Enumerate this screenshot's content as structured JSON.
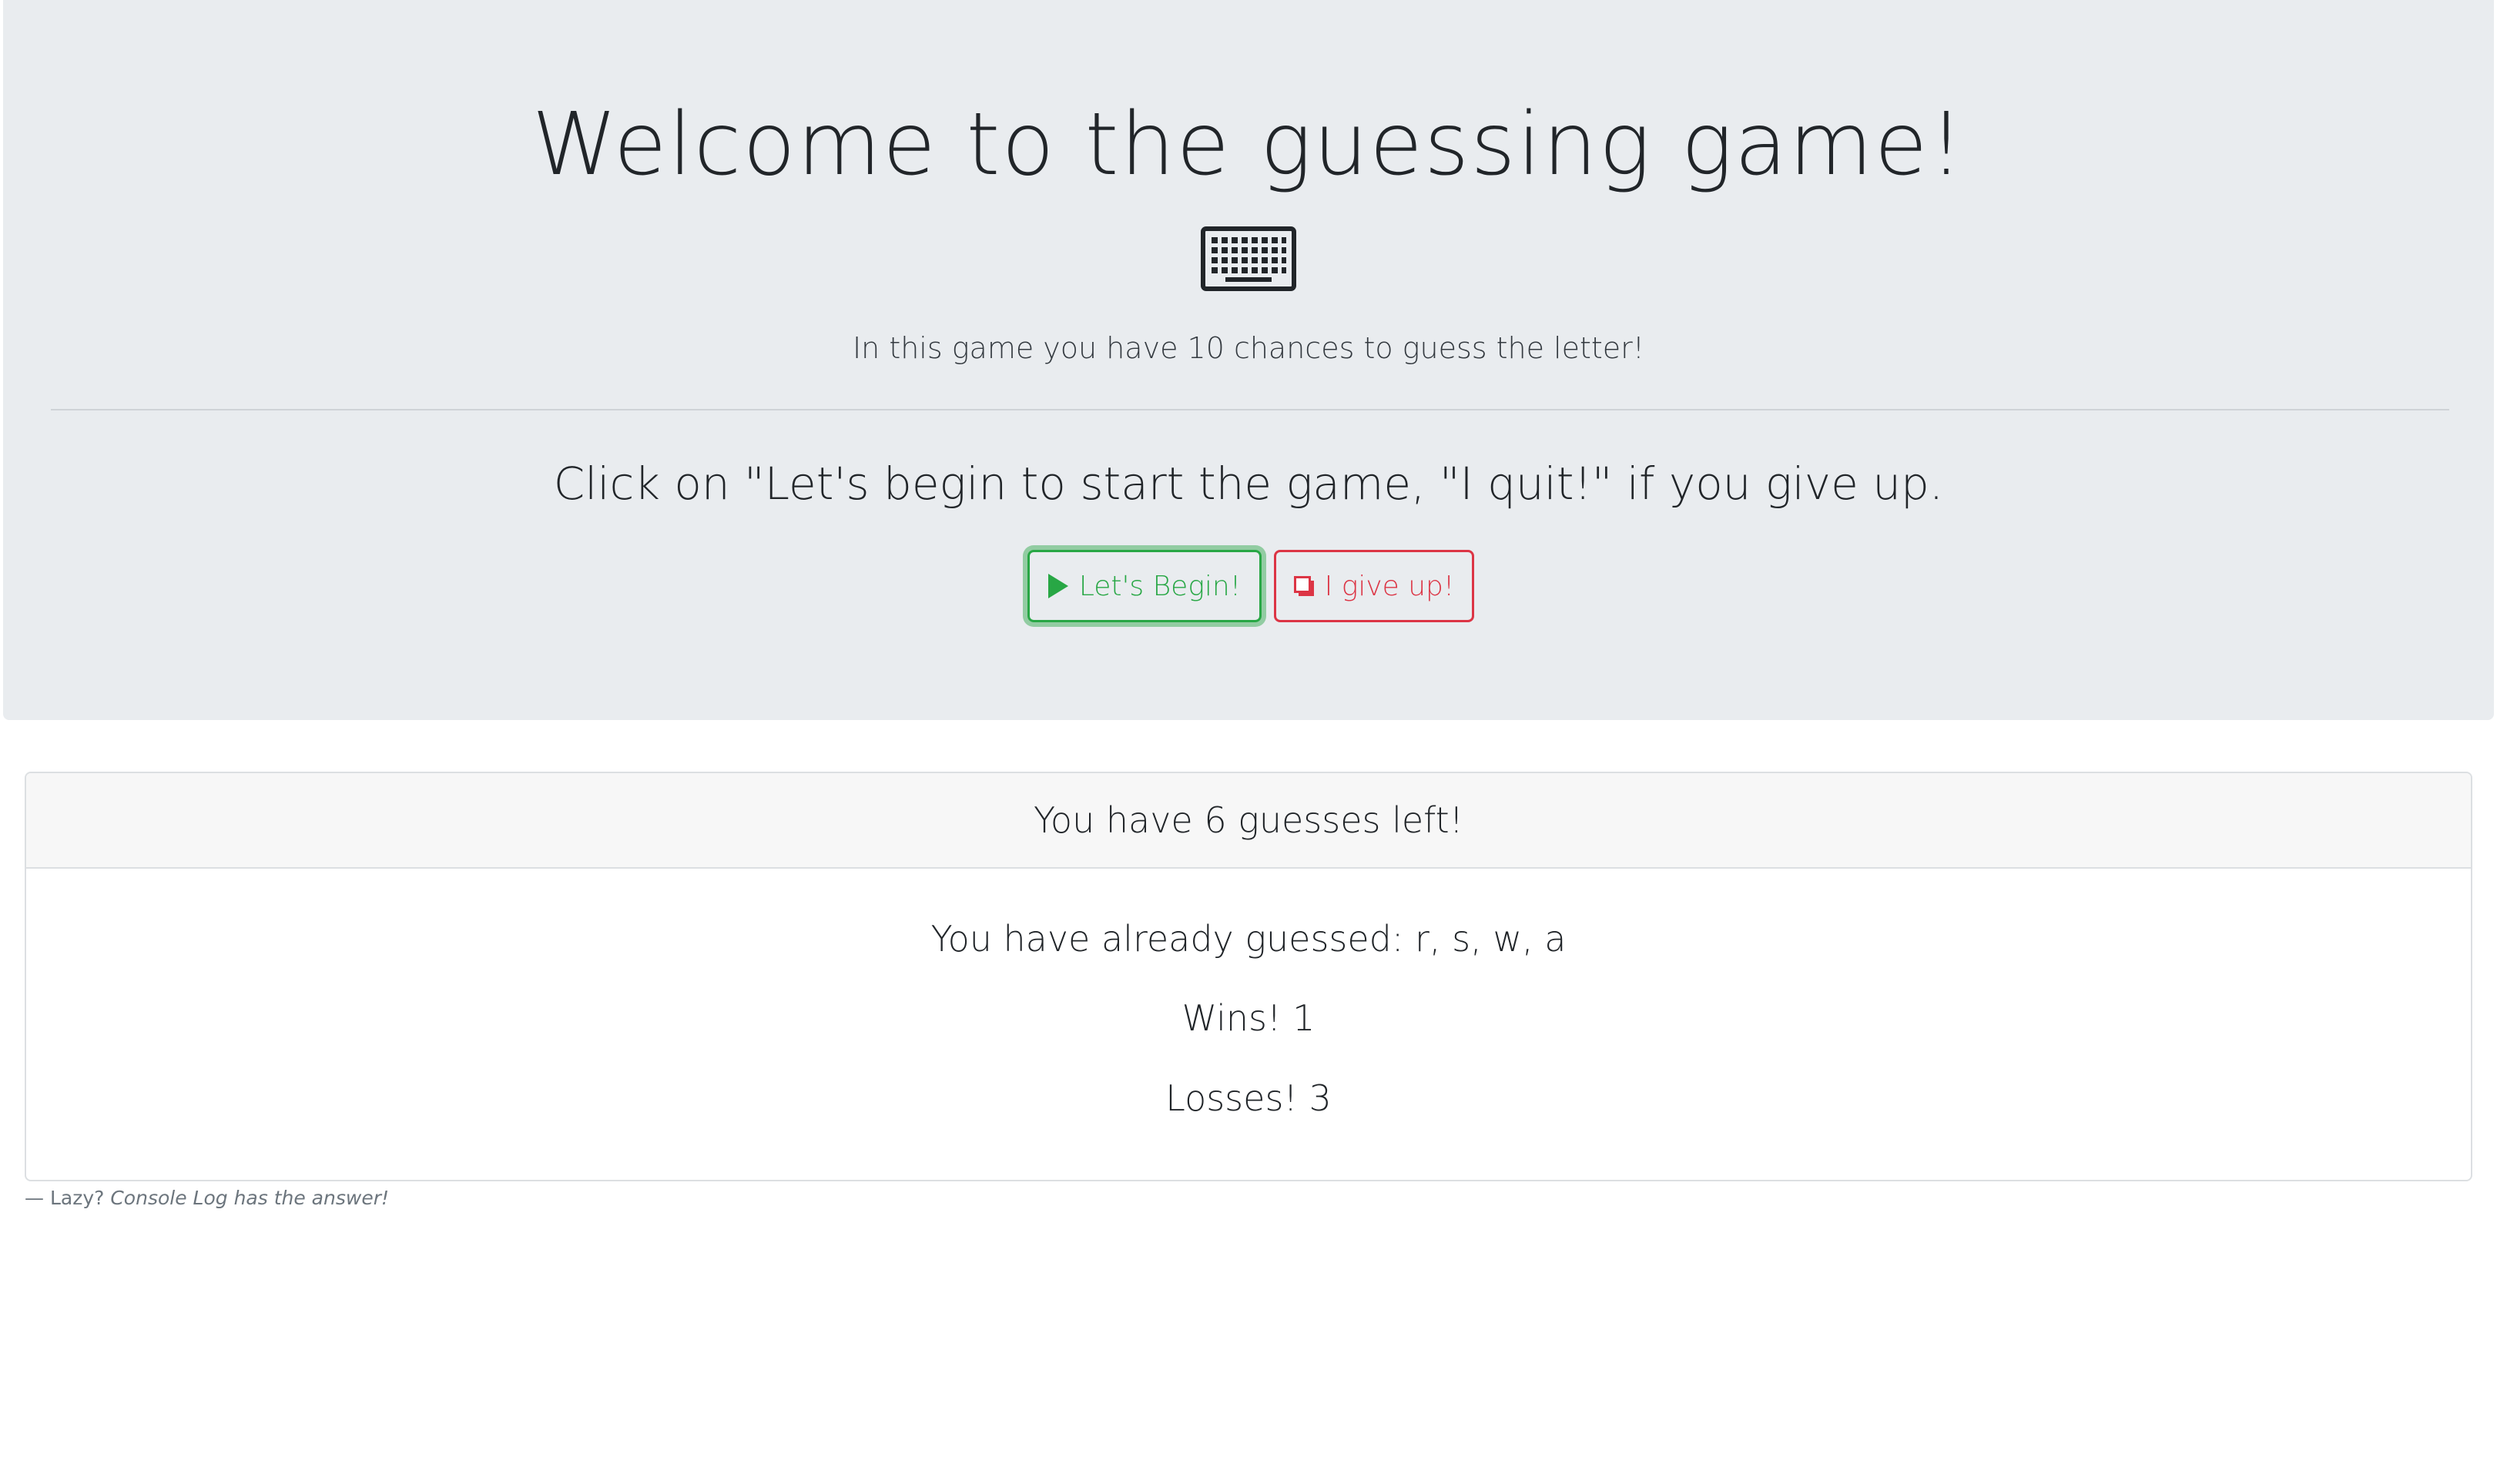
{
  "header": {
    "title": "Welcome to the guessing game!",
    "icon": "keyboard-icon",
    "lead": "In this game you have 10 chances to guess the letter!",
    "instruction": "Click on \"Let's begin to start the game, \"I quit!\" if you give up."
  },
  "buttons": {
    "begin_label": "Let's Begin!",
    "begin_icon": "play-icon",
    "quit_label": "I give up!",
    "quit_icon": "quit-icon"
  },
  "colors": {
    "success": "#28a745",
    "danger": "#dc3545",
    "jumbotron_bg": "#e9ecef"
  },
  "card": {
    "header": "You have 6 guesses left!",
    "guessed": "You have already guessed: r, s, w, a",
    "wins": "Wins! 1",
    "losses": "Losses! 3"
  },
  "footer": {
    "prefix": "— Lazy?",
    "cite": "Console Log has the answer!"
  }
}
